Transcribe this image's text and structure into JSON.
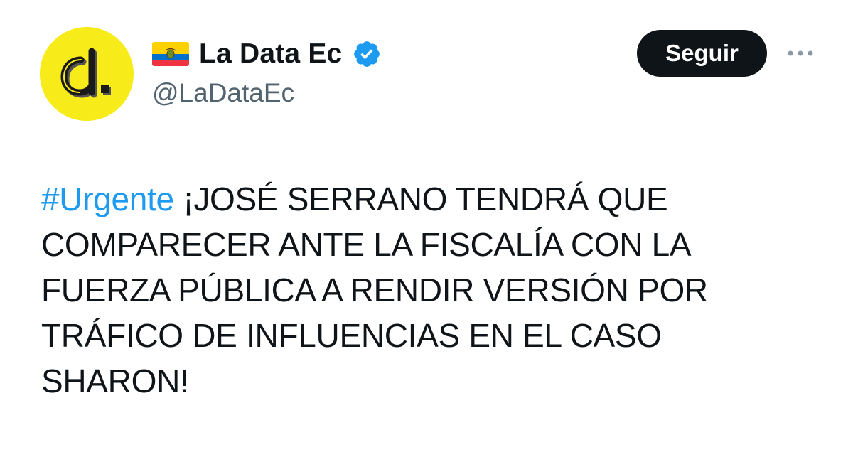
{
  "tweet": {
    "author": {
      "avatar_letter": "d.",
      "flag_icon": "ecuador-flag-icon",
      "display_name": "La Data Ec",
      "verified_icon": "verified-badge-icon",
      "handle": "@LaDataEc"
    },
    "actions": {
      "follow_label": "Seguir",
      "more_icon": "more-horizontal-icon"
    },
    "body": {
      "hashtag": "#Urgente",
      "text": "¡JOSÉ SERRANO TENDRÁ QUE COMPARECER ANTE LA FISCALÍA CON LA FUERZA PÚBLICA A RENDIR VERSIÓN POR TRÁFICO DE INFLUENCIAS EN EL CASO SHARON!"
    },
    "colors": {
      "hashtag": "#1d9bf0",
      "verified": "#1d9bf0",
      "follow_button_bg": "#0f1419",
      "avatar_bg": "#f7ec1a",
      "handle": "#536471"
    }
  }
}
